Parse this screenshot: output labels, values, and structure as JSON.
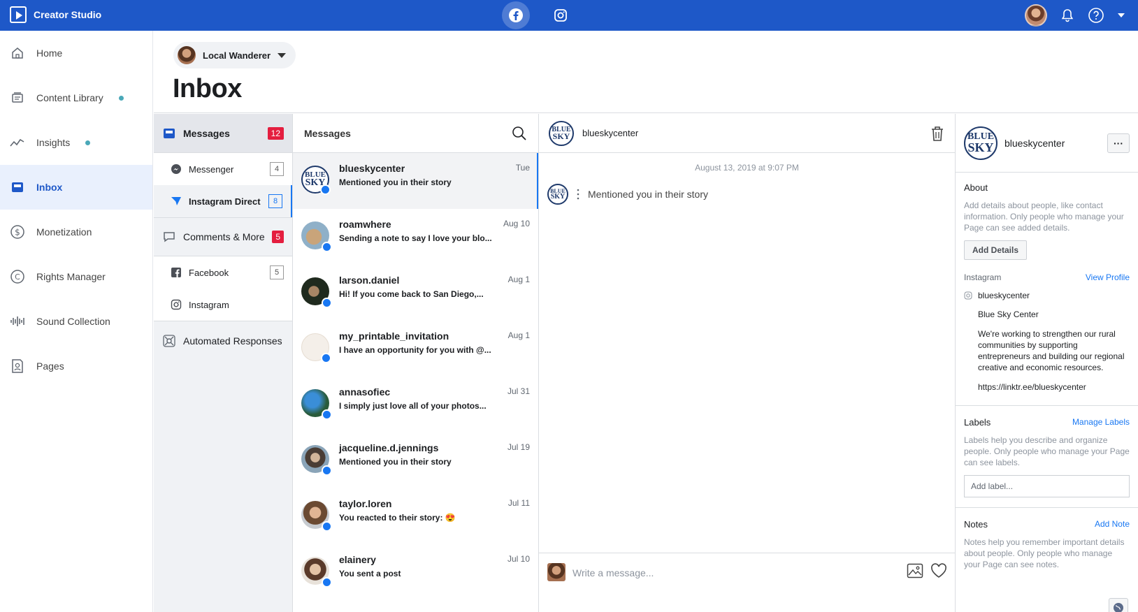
{
  "app": {
    "title": "Creator Studio"
  },
  "colors": {
    "topbar": "#1e58c8",
    "accent": "#1877f2",
    "badge_red": "#e41e3f",
    "dot": "#4aa8b8"
  },
  "leftnav": {
    "items": [
      {
        "label": "Home",
        "icon": "home-icon"
      },
      {
        "label": "Content Library",
        "icon": "content-library-icon",
        "dot": true
      },
      {
        "label": "Insights",
        "icon": "insights-icon",
        "dot": true
      },
      {
        "label": "Inbox",
        "icon": "inbox-icon",
        "active": true
      },
      {
        "label": "Monetization",
        "icon": "dollar-icon"
      },
      {
        "label": "Rights Manager",
        "icon": "copyright-icon"
      },
      {
        "label": "Sound Collection",
        "icon": "sound-wave-icon"
      },
      {
        "label": "Pages",
        "icon": "pages-icon"
      }
    ]
  },
  "header": {
    "page_name": "Local Wanderer",
    "title": "Inbox"
  },
  "subnav": {
    "messages": {
      "label": "Messages",
      "count": "12"
    },
    "messenger": {
      "label": "Messenger",
      "count": "4"
    },
    "instagram_direct": {
      "label": "Instagram Direct",
      "count": "8"
    },
    "comments": {
      "label": "Comments & More",
      "count": "5"
    },
    "facebook": {
      "label": "Facebook",
      "count": "5"
    },
    "instagram": {
      "label": "Instagram"
    },
    "automated": {
      "label": "Automated Responses"
    }
  },
  "conversations": {
    "title": "Messages",
    "items": [
      {
        "name": "blueskycenter",
        "snippet": "Mentioned you in their story",
        "date": "Tue"
      },
      {
        "name": "roamwhere",
        "snippet": "Sending a note to say I love your blo...",
        "date": "Aug 10"
      },
      {
        "name": "larson.daniel",
        "snippet": "Hi! If you come back to San Diego,...",
        "date": "Aug 1"
      },
      {
        "name": "my_printable_invitation",
        "snippet": "I have an opportunity for you with @...",
        "date": "Aug 1"
      },
      {
        "name": "annasofiec",
        "snippet": "I simply just love all of your photos...",
        "date": "Jul 31"
      },
      {
        "name": "jacqueline.d.jennings",
        "snippet": "Mentioned you in their story",
        "date": "Jul 19"
      },
      {
        "name": "taylor.loren",
        "snippet": "You reacted to their story: 😍",
        "date": "Jul 11"
      },
      {
        "name": "elainery",
        "snippet": "You sent a post",
        "date": "Jul 10"
      }
    ]
  },
  "thread": {
    "username": "blueskycenter",
    "timestamp": "August 13, 2019 at 9:07 PM",
    "message": "Mentioned you in their story",
    "composer_placeholder": "Write a message..."
  },
  "logo": {
    "line1": "BLUE",
    "line2": "SKY"
  },
  "profile": {
    "username": "blueskycenter",
    "more": "···",
    "about": {
      "title": "About",
      "desc": "Add details about people, like contact information. Only people who manage your Page can see added details.",
      "button": "Add Details"
    },
    "instagram": {
      "title": "Instagram",
      "link": "View Profile",
      "handle": "blueskycenter",
      "name": "Blue Sky Center",
      "bio": "We're working to strengthen our rural communities by supporting entrepreneurs and building our regional creative and economic resources.",
      "url": "https://linktr.ee/blueskycenter"
    },
    "labels": {
      "title": "Labels",
      "link": "Manage Labels",
      "desc": "Labels help you describe and organize people. Only people who manage your Page can see labels.",
      "placeholder": "Add label..."
    },
    "notes": {
      "title": "Notes",
      "link": "Add Note",
      "desc": "Notes help you remember important details about people. Only people who manage your Page can see notes."
    }
  }
}
